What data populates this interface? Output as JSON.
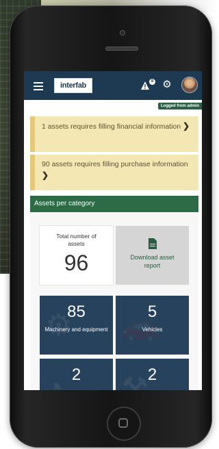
{
  "topbar": {
    "logo_text": "interfab",
    "notifications_count": "8",
    "logged_status": "Logged from admin"
  },
  "alerts": [
    {
      "text": "1 assets requires filling financial information",
      "chevron": "❯"
    },
    {
      "text": "90 assets requires filling purchase information",
      "chevron": "❯"
    }
  ],
  "assets": {
    "header": "Assets per category",
    "total_label": "Total number of assets",
    "total_value": "96",
    "download_label": "Download asset report",
    "categories": [
      {
        "value": "85",
        "label": "Machinery and equipment",
        "icon": "gears-icon"
      },
      {
        "value": "5",
        "label": "Vehicles",
        "icon": "car-icon"
      },
      {
        "value": "2",
        "label": "",
        "icon": "tool-icon"
      },
      {
        "value": "2",
        "label": "",
        "icon": "wrench-icon"
      }
    ]
  },
  "colors": {
    "navbar": "#1e3a52",
    "alert_bg": "#f3e7b4",
    "alert_border": "#e5c878",
    "category_header": "#2c6b46",
    "tile": "#27425c"
  }
}
